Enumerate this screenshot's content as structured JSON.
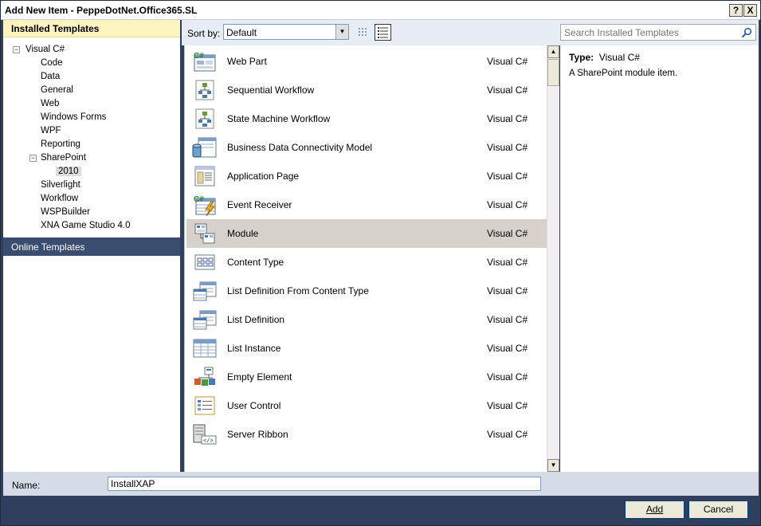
{
  "window": {
    "title": "Add New Item - PeppeDotNet.Office365.SL",
    "help_glyph": "?",
    "close_glyph": "X"
  },
  "left_panel": {
    "installed_header": "Installed Templates",
    "tree": [
      {
        "label": "Visual C#",
        "level": 0,
        "expander": "−"
      },
      {
        "label": "Code",
        "level": 1
      },
      {
        "label": "Data",
        "level": 1
      },
      {
        "label": "General",
        "level": 1
      },
      {
        "label": "Web",
        "level": 1
      },
      {
        "label": "Windows Forms",
        "level": 1
      },
      {
        "label": "WPF",
        "level": 1
      },
      {
        "label": "Reporting",
        "level": 1
      },
      {
        "label": "SharePoint",
        "level": 1,
        "expander": "−"
      },
      {
        "label": "2010",
        "level": 2,
        "selected": true
      },
      {
        "label": "Silverlight",
        "level": 1
      },
      {
        "label": "Workflow",
        "level": 1
      },
      {
        "label": "WSPBuilder",
        "level": 1
      },
      {
        "label": "XNA Game Studio 4.0",
        "level": 1
      }
    ],
    "online_header": "Online Templates"
  },
  "toolbar": {
    "sort_label": "Sort by:",
    "sort_value": "Default",
    "search_placeholder": "Search Installed Templates"
  },
  "templates": [
    {
      "name": "Web Part",
      "lang": "Visual C#",
      "icon": "web-part-icon"
    },
    {
      "name": "Sequential Workflow",
      "lang": "Visual C#",
      "icon": "sequential-workflow-icon"
    },
    {
      "name": "State Machine Workflow",
      "lang": "Visual C#",
      "icon": "state-machine-workflow-icon"
    },
    {
      "name": "Business Data Connectivity Model",
      "lang": "Visual C#",
      "icon": "bdc-model-icon"
    },
    {
      "name": "Application Page",
      "lang": "Visual C#",
      "icon": "application-page-icon"
    },
    {
      "name": "Event Receiver",
      "lang": "Visual C#",
      "icon": "event-receiver-icon"
    },
    {
      "name": "Module",
      "lang": "Visual C#",
      "icon": "module-icon",
      "selected": true
    },
    {
      "name": "Content Type",
      "lang": "Visual C#",
      "icon": "content-type-icon"
    },
    {
      "name": "List Definition From Content Type",
      "lang": "Visual C#",
      "icon": "list-definition-content-type-icon"
    },
    {
      "name": "List Definition",
      "lang": "Visual C#",
      "icon": "list-definition-icon"
    },
    {
      "name": "List Instance",
      "lang": "Visual C#",
      "icon": "list-instance-icon"
    },
    {
      "name": "Empty Element",
      "lang": "Visual C#",
      "icon": "empty-element-icon"
    },
    {
      "name": "User Control",
      "lang": "Visual C#",
      "icon": "user-control-icon"
    },
    {
      "name": "Server Ribbon",
      "lang": "Visual C#",
      "icon": "server-ribbon-icon"
    }
  ],
  "details": {
    "type_label": "Type:",
    "type_value": "Visual C#",
    "description": "A SharePoint module item."
  },
  "name_row": {
    "label": "Name:",
    "value": "InstallXAP"
  },
  "buttons": {
    "add": "Add",
    "cancel": "Cancel"
  },
  "colors": {
    "selected_item_bg": "#d6d2cb",
    "installed_header_bg": "#fdf4bf",
    "online_header_bg": "#3a4d6e",
    "window_bg": "#2f3f5c"
  }
}
